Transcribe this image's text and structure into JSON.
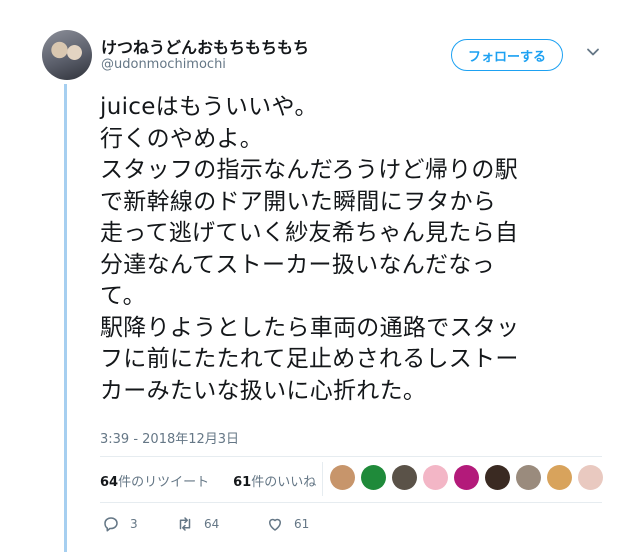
{
  "user": {
    "display_name": "けつねうどんおもちもちもち",
    "handle": "@udonmochimochi",
    "follow_label": "フォローする"
  },
  "tweet": {
    "lines": [
      "juiceはもういいや。",
      "行くのやめよ。",
      "スタッフの指示なんだろうけど帰りの駅",
      "で新幹線のドア開いた瞬間にヲタから",
      "走って逃げていく紗友希ちゃん見たら自",
      "分達なんてストーカー扱いなんだなっ",
      "て。",
      "駅降りようとしたら車両の通路でスタッ",
      "フに前にたたれて足止めされるしストー",
      "カーみたいな扱いに心折れた。"
    ],
    "timestamp": "3:39 - 2018年12月3日"
  },
  "stats": {
    "retweet_count": "64",
    "retweet_label": "件のリツイート",
    "like_count": "61",
    "like_label": "件のいいね"
  },
  "liker_avatars": [
    {
      "icon": "liker-avatar",
      "color": "#c7956b"
    },
    {
      "icon": "liker-avatar",
      "color": "#1f8a3a"
    },
    {
      "icon": "liker-avatar",
      "color": "#5a5248"
    },
    {
      "icon": "liker-avatar",
      "color": "#f3b6c6"
    },
    {
      "icon": "liker-avatar",
      "color": "#b31a7a"
    },
    {
      "icon": "liker-avatar",
      "color": "#3a2a22"
    },
    {
      "icon": "liker-avatar",
      "color": "#9a8b7d"
    },
    {
      "icon": "liker-avatar",
      "color": "#d8a35c"
    },
    {
      "icon": "liker-avatar",
      "color": "#e9c9c0"
    }
  ],
  "actions": {
    "reply_count": "3",
    "retweet_count": "64",
    "like_count": "61"
  },
  "colors": {
    "accent": "#1da1f2",
    "thread_line": "#a6cff0",
    "muted": "#657786"
  }
}
